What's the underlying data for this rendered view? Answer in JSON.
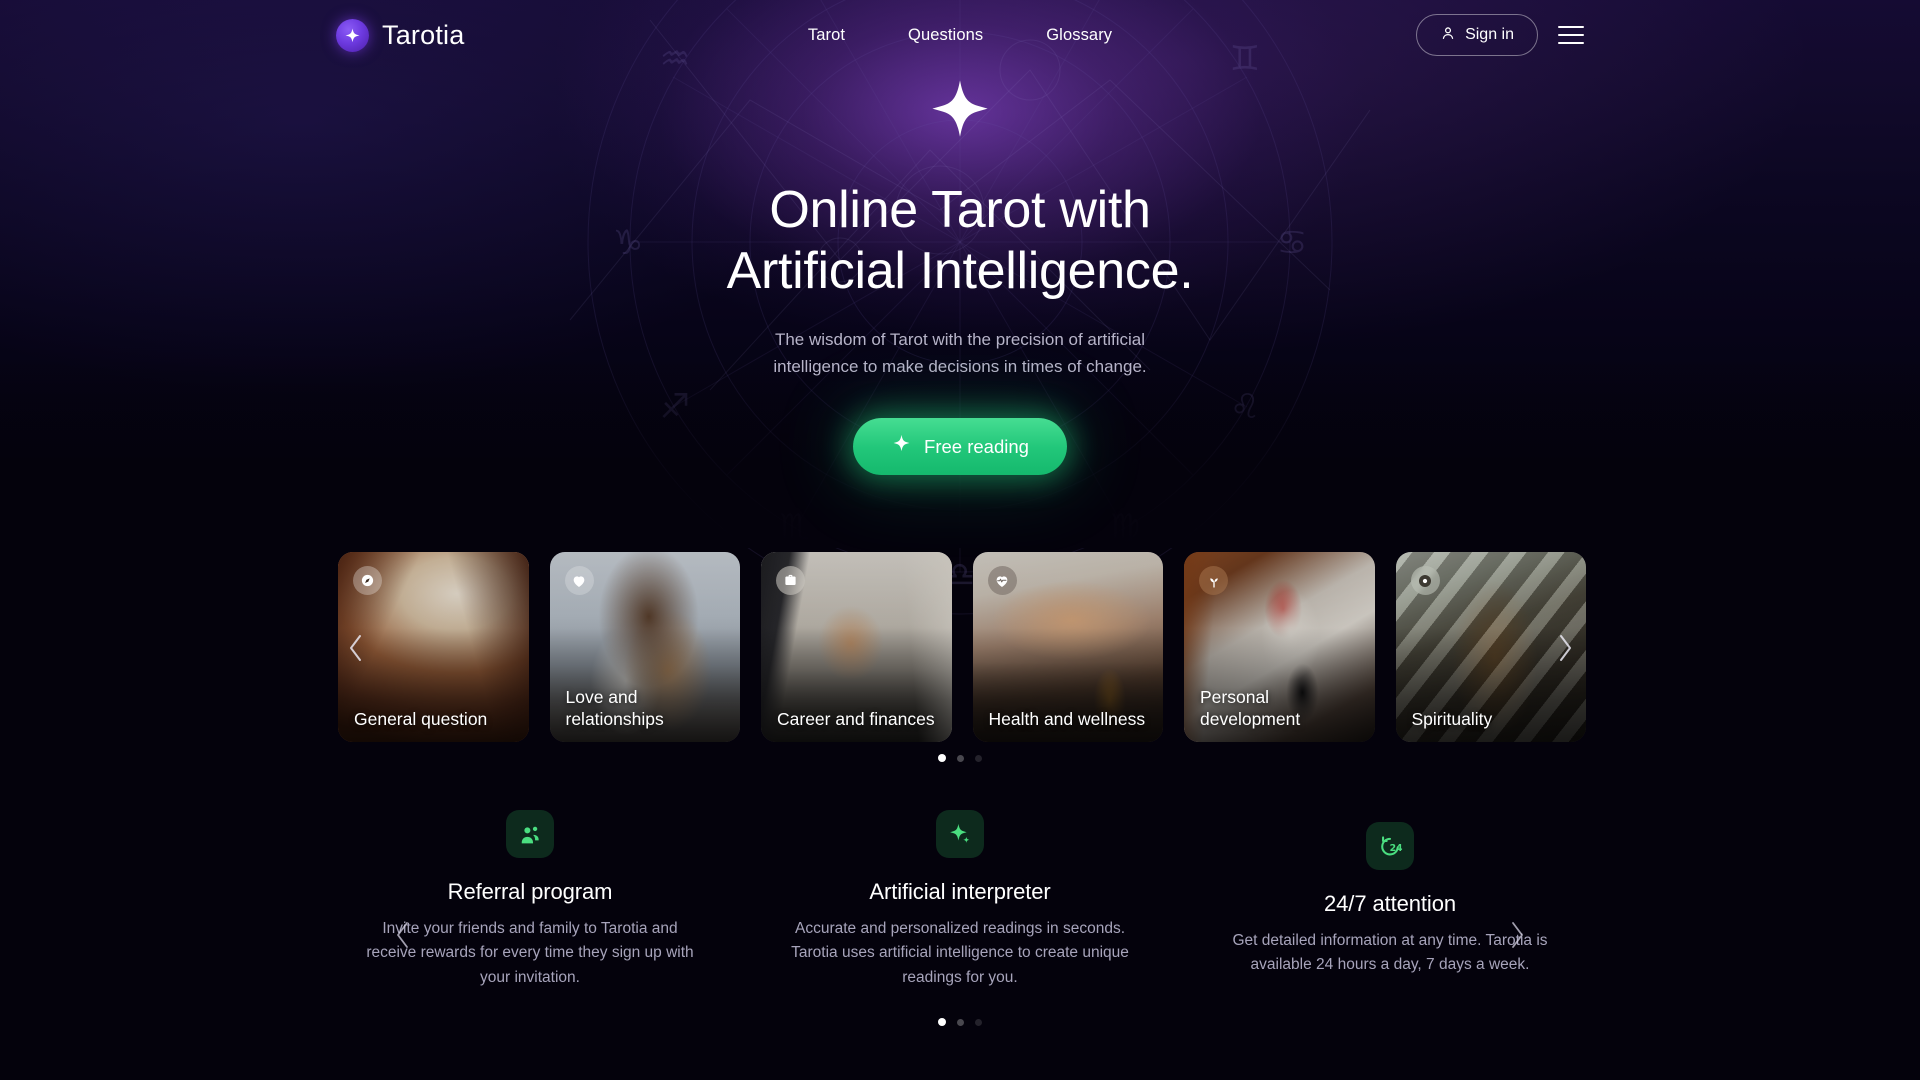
{
  "brand": {
    "name": "Tarotia",
    "logo_icon": "sparkle-icon"
  },
  "header": {
    "nav": [
      {
        "label": "Tarot"
      },
      {
        "label": "Questions"
      },
      {
        "label": "Glossary"
      }
    ],
    "sign_in_label": "Sign in",
    "sign_in_icon": "user-icon",
    "menu_icon": "hamburger-menu-icon"
  },
  "hero": {
    "star_icon": "sparkle-icon",
    "title_line1": "Online Tarot with",
    "title_line2": "Artificial Intelligence.",
    "subtitle": "The wisdom of Tarot with the precision of artificial intelligence to make decisions in times of change.",
    "cta_label": "Free reading",
    "cta_icon": "sparkle-icon",
    "cta_color": "#22c77a"
  },
  "categories": {
    "prev_icon": "chevron-left-icon",
    "next_icon": "chevron-right-icon",
    "items": [
      {
        "label": "General question",
        "icon": "compass-icon"
      },
      {
        "label": "Love and relationships",
        "icon": "heart-icon"
      },
      {
        "label": "Career and finances",
        "icon": "briefcase-icon"
      },
      {
        "label": "Health and wellness",
        "icon": "heart-pulse-icon"
      },
      {
        "label": "Personal development",
        "icon": "sprout-icon"
      },
      {
        "label": "Spirituality",
        "icon": "circle-dot-icon"
      }
    ],
    "dots": [
      {
        "active": true
      },
      {
        "active": false
      },
      {
        "active": false
      }
    ]
  },
  "features": {
    "prev_icon": "chevron-left-icon",
    "next_icon": "chevron-right-icon",
    "items": [
      {
        "icon": "people-group-icon",
        "title": "Referral program",
        "text": "Invite your friends and family to Tarotia and receive rewards for every time they sign up with your invitation."
      },
      {
        "icon": "sparkle-icon",
        "title": "Artificial interpreter",
        "text": "Accurate and personalized readings in seconds. Tarotia uses artificial intelligence to create unique readings for you."
      },
      {
        "icon": "clock-24-icon",
        "title": "24/7 attention",
        "text": "Get detailed information at any time. Tarotia is available 24 hours a day, 7 days a week."
      }
    ],
    "dots": [
      {
        "active": true
      },
      {
        "active": false
      },
      {
        "active": false
      }
    ]
  },
  "colors": {
    "background": "#04020c",
    "hero_gradient_top": "#150b33",
    "accent_green": "#22c77a",
    "accent_purple": "#7c3aed",
    "text_muted": "#a7a4bb"
  }
}
